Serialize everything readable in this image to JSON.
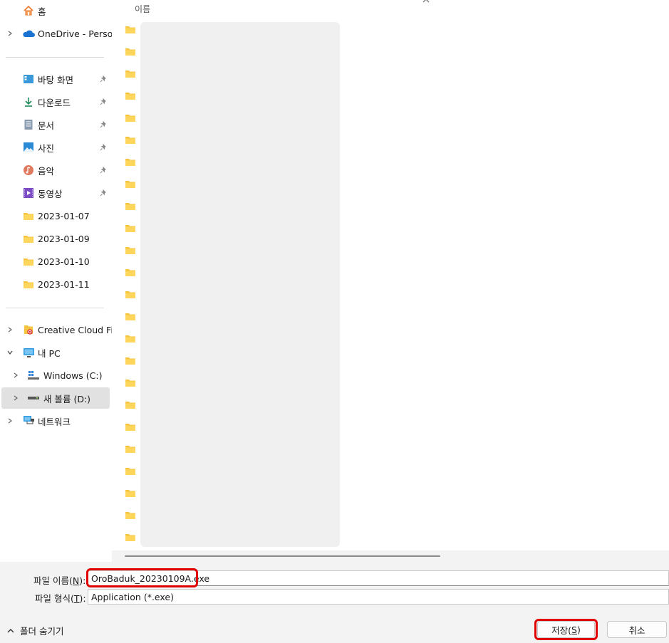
{
  "sidebar": {
    "quick": [
      {
        "label": "홈",
        "icon": "home-icon"
      },
      {
        "label": "OneDrive - Persona",
        "icon": "onedrive-cloud-icon"
      }
    ],
    "pinned": [
      {
        "label": "바탕 화면",
        "icon": "desktop-icon"
      },
      {
        "label": "다운로드",
        "icon": "download-icon"
      },
      {
        "label": "문서",
        "icon": "document-icon"
      },
      {
        "label": "사진",
        "icon": "pictures-icon"
      },
      {
        "label": "음악",
        "icon": "music-icon"
      },
      {
        "label": "동영상",
        "icon": "video-icon"
      }
    ],
    "recent_folders": [
      "2023-01-07",
      "2023-01-09",
      "2023-01-10",
      "2023-01-11"
    ],
    "locations": [
      {
        "label": "Creative Cloud File",
        "icon": "creative-cloud-icon"
      },
      {
        "label": "내 PC",
        "icon": "this-pc-icon"
      },
      {
        "label": "Windows (C:)",
        "icon": "windows-drive-icon"
      },
      {
        "label": "새 볼륨 (D:)",
        "icon": "drive-icon"
      },
      {
        "label": "네트워크",
        "icon": "network-icon"
      }
    ]
  },
  "main": {
    "column_header": "이름",
    "sort_indicator": "^",
    "folder_row_count": 24
  },
  "bottom": {
    "filename_label_pre": "파일 이름(",
    "filename_label_key": "N",
    "filename_label_post": "):",
    "filename_value": "OroBaduk_20230109A.exe",
    "filetype_label_pre": "파일 형식(",
    "filetype_label_key": "T",
    "filetype_label_post": "):",
    "filetype_value": "Application (*.exe)",
    "hide_folders_label": "폴더 숨기기",
    "save_label_pre": "저장(",
    "save_label_key": "S",
    "save_label_post": ")",
    "cancel_label": "취소"
  },
  "colors": {
    "highlight": "#e00000",
    "folder": "#f5c542",
    "selected_bg": "#e1e1e1"
  }
}
